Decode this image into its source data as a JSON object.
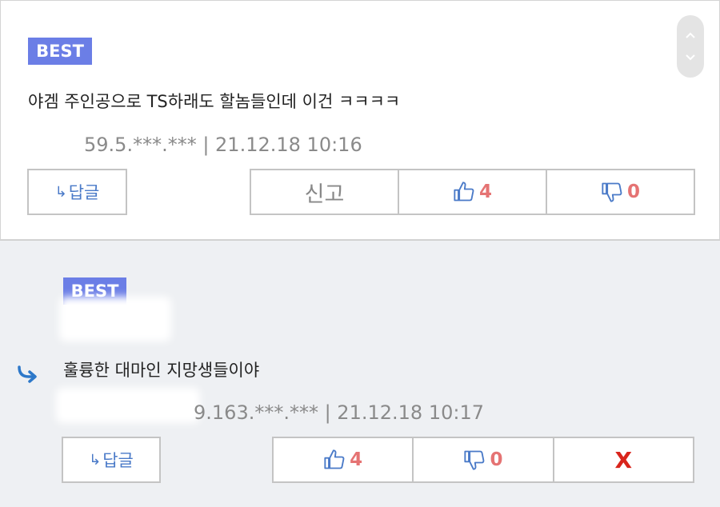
{
  "comments": [
    {
      "badge": "BEST",
      "text": "야겜 주인공으로 TS하래도 할놈들인데 이건 ㅋㅋㅋㅋ",
      "meta": "59.5.***.*** | 21.12.18 10:16",
      "reply_label": "답글",
      "report_label": "신고",
      "likes": "4",
      "dislikes": "0"
    },
    {
      "badge": "BEST",
      "text": "훌륭한 대마인 지망생들이야",
      "meta": "9.163.***.*** | 21.12.18 10:17",
      "reply_label": "답글",
      "likes": "4",
      "dislikes": "0",
      "delete_label": "X"
    }
  ],
  "colors": {
    "badge": "#6b7ee6",
    "like_count": "#e57373",
    "accent_blue": "#4a7ac8",
    "delete": "#d9251c",
    "reply_bg": "#eef0f3"
  },
  "icons": [
    "reply-arrow-icon",
    "thumbs-up-icon",
    "thumbs-down-icon",
    "scroll-up-icon",
    "scroll-down-icon",
    "reply-indicator-icon"
  ]
}
